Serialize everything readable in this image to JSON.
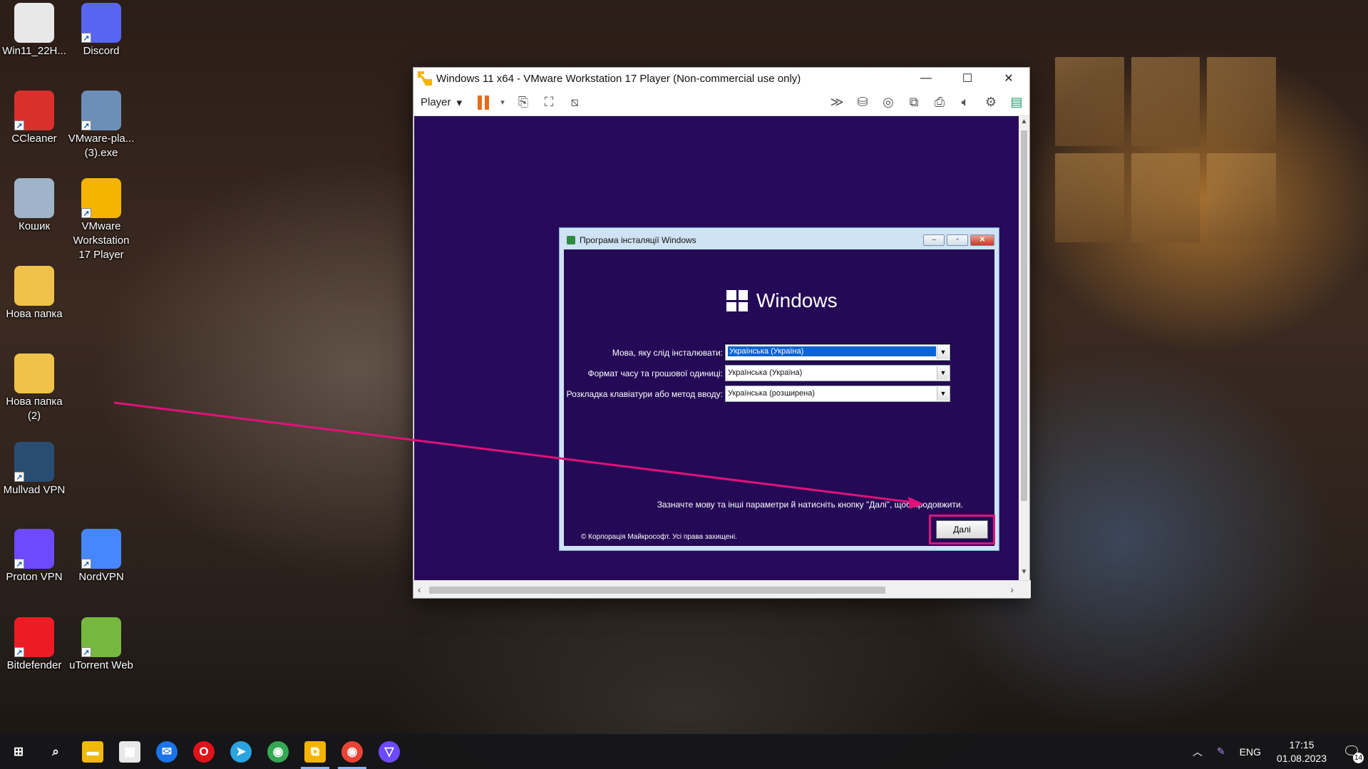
{
  "desktop": {
    "icons": [
      {
        "label": "Win11_22H...",
        "icon": "disc-image-icon",
        "color": "#e8e8e8"
      },
      {
        "label": "Discord",
        "icon": "discord-icon",
        "color": "#5865f2"
      },
      {
        "label": "CCleaner",
        "icon": "ccleaner-icon",
        "color": "#d9302c"
      },
      {
        "label": "VMware-pla...\n(3).exe",
        "icon": "installer-icon",
        "color": "#6c8fb8"
      },
      {
        "label": "Кошик",
        "icon": "recycle-bin-icon",
        "color": "#9fb4c8"
      },
      {
        "label": "VMware\nWorkstation\n17 Player",
        "icon": "vmware-icon",
        "color": "#f5b400"
      },
      {
        "label": "Нова папка",
        "icon": "folder-icon",
        "color": "#f0c24a"
      },
      {
        "label": "Нова папка\n(2)",
        "icon": "folder-icon",
        "color": "#f0c24a"
      },
      {
        "label": "Mullvad VPN",
        "icon": "mullvad-icon",
        "color": "#294d73"
      },
      {
        "label": "Proton VPN",
        "icon": "protonvpn-icon",
        "color": "#6d4aff"
      },
      {
        "label": "NordVPN",
        "icon": "nordvpn-icon",
        "color": "#4687ff"
      },
      {
        "label": "Bitdefender",
        "icon": "bitdefender-icon",
        "color": "#ed1c24"
      },
      {
        "label": "uTorrent Web",
        "icon": "utorrent-icon",
        "color": "#76b83f"
      }
    ]
  },
  "vm_window": {
    "title": "Windows 11 x64 - VMware Workstation 17 Player (Non-commercial use only)",
    "menu_label": "Player",
    "minimize": "—",
    "maximize": "☐",
    "close": "✕"
  },
  "setup": {
    "title": "Програма інсталяції Windows",
    "logo_text": "Windows",
    "language_label": "Мова, яку слід інсталювати:",
    "language_value": "Українська (Україна)",
    "format_label": "Формат часу та грошової одиниці:",
    "format_value": "Українська (Україна)",
    "keyboard_label": "Розкладка клавіатури або метод вводу:",
    "keyboard_value": "Українська (розширена)",
    "hint": "Зазначте мову та інші параметри й натисніть кнопку \"Далі\", щоб продовжити.",
    "copyright": "© Корпорація Майкрософт. Усі права захищені.",
    "next_label": "Далі"
  },
  "taskbar": {
    "apps": [
      {
        "name": "start-button",
        "glyph": "⊞",
        "color": "transparent"
      },
      {
        "name": "search-icon",
        "glyph": "⌕",
        "color": "transparent"
      },
      {
        "name": "file-explorer-icon",
        "glyph": "▬",
        "color": "#f0b90b"
      },
      {
        "name": "microsoft-store-icon",
        "glyph": "▦",
        "color": "#e8e8e8"
      },
      {
        "name": "mail-icon",
        "glyph": "✉",
        "color": "#1a73e8"
      },
      {
        "name": "opera-icon",
        "glyph": "O",
        "color": "#e0121a"
      },
      {
        "name": "telegram-icon",
        "glyph": "➤",
        "color": "#2aa3df"
      },
      {
        "name": "chrome-icon",
        "glyph": "◉",
        "color": "#34a853"
      },
      {
        "name": "vmware-taskbar-icon",
        "glyph": "⧉",
        "color": "#f5b400"
      },
      {
        "name": "chrome-profile-icon",
        "glyph": "◉",
        "color": "#ea4335"
      },
      {
        "name": "protonvpn-taskbar-icon",
        "glyph": "▽",
        "color": "#6d4aff"
      }
    ],
    "language": "ENG",
    "time": "17:15",
    "date": "01.08.2023",
    "notifications": "14"
  },
  "colors": {
    "highlight": "#e0127a",
    "vm_background": "#280a5a",
    "setup_background": "#240a56"
  }
}
